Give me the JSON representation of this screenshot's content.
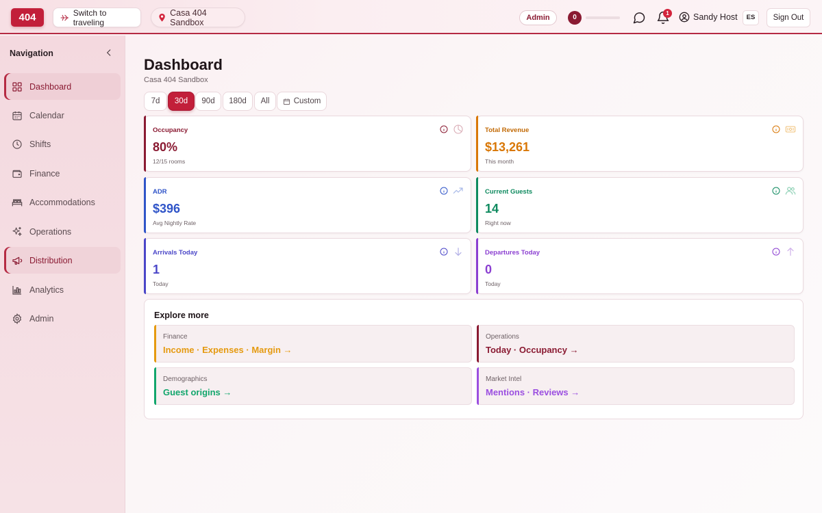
{
  "topbar": {
    "logo": "404",
    "switch_label": "Switch to traveling",
    "property_label": "Casa 404 Sandbox",
    "role_badge": "Admin",
    "counter": "0",
    "progress": 0,
    "notifications": "1",
    "user_name": "Sandy Host",
    "language": "ES",
    "sign_out": "Sign Out"
  },
  "sidebar": {
    "title": "Navigation",
    "items": [
      {
        "label": "Dashboard",
        "icon": "grid-icon"
      },
      {
        "label": "Calendar",
        "icon": "calendar-icon"
      },
      {
        "label": "Shifts",
        "icon": "clock-icon"
      },
      {
        "label": "Finance",
        "icon": "wallet-icon"
      },
      {
        "label": "Accommodations",
        "icon": "bed-icon"
      },
      {
        "label": "Operations",
        "icon": "sparkles-icon"
      },
      {
        "label": "Distribution",
        "icon": "megaphone-icon"
      },
      {
        "label": "Analytics",
        "icon": "bar-chart-icon"
      },
      {
        "label": "Admin",
        "icon": "gear-icon"
      }
    ]
  },
  "main": {
    "title": "Dashboard",
    "subtitle": "Casa 404 Sandbox",
    "ranges": [
      "7d",
      "30d",
      "90d",
      "180d",
      "All",
      "Custom"
    ],
    "active_range": "30d",
    "cards": [
      {
        "label": "Occupancy",
        "value": "80%",
        "sub": "12/15 rooms",
        "color": "#8a1a32",
        "icon": "pie-chart-icon"
      },
      {
        "label": "Total Revenue",
        "value": "$13,261",
        "sub": "This month",
        "color": "#d97706",
        "icon": "banknote-icon"
      },
      {
        "label": "ADR",
        "value": "$396",
        "sub": "Avg Nightly Rate",
        "color": "#2f54c8",
        "icon": "trend-up-icon"
      },
      {
        "label": "Current Guests",
        "value": "14",
        "sub": "Right now",
        "color": "#0f8a5f",
        "icon": "users-icon"
      },
      {
        "label": "Arrivals Today",
        "value": "1",
        "sub": "Today",
        "color": "#4a46c8",
        "icon": "arrow-down-icon"
      },
      {
        "label": "Departures Today",
        "value": "0",
        "sub": "Today",
        "color": "#8b3fd1",
        "icon": "arrow-up-icon"
      }
    ],
    "explore": {
      "title": "Explore more",
      "links": [
        {
          "label": "Finance",
          "link": "Income · Expenses · Margin →",
          "color": "#e59a10"
        },
        {
          "label": "Operations",
          "link": "Today · Occupancy →",
          "color": "#8a1a32"
        },
        {
          "label": "Demographics",
          "link": "Guest origins →",
          "color": "#12a66c"
        },
        {
          "label": "Market Intel",
          "link": "Mentions · Reviews →",
          "color": "#9b4fe0"
        }
      ]
    }
  }
}
